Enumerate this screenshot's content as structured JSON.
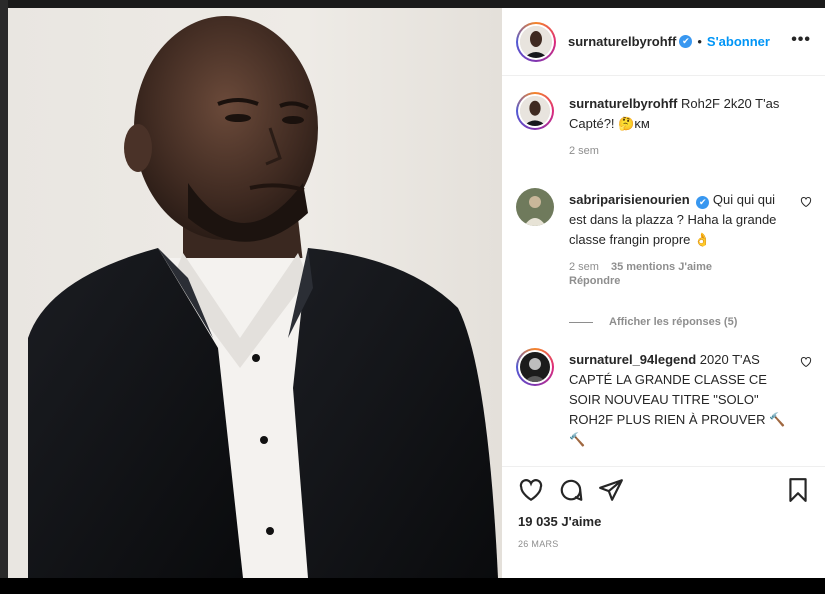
{
  "post": {
    "author": "surnaturelbyrohff",
    "verified_mark": "✔",
    "follow_label": "S'abonner",
    "more_glyph": "•••",
    "caption_text": "Roh2F 2k20 T'as Capté?! 🤔ᴋᴍ",
    "caption_time": "2 sem"
  },
  "comments": [
    {
      "user": "sabriparisienourien",
      "verified": true,
      "text": "Qui qui qui est dans la plazza ? Haha la grande classe frangin propre 👌",
      "time": "2 sem",
      "likes": "35 mentions J'aime",
      "reply": "Répondre",
      "view_replies": "Afficher les réponses (5)"
    },
    {
      "user": "surnaturel_94legend",
      "verified": false,
      "text": "2020 T'AS CAPTÉ LA GRANDE CLASSE CE SOIR NOUVEAU TITRE \"SOLO\" ROH2F PLUS RIEN À PROUVER 🔨🔨"
    }
  ],
  "footer": {
    "likes_count": "19 035 J'aime",
    "date": "26 MARS"
  },
  "icons": [
    "heart-icon",
    "comment-icon",
    "share-icon",
    "bookmark-icon",
    "more-options-icon",
    "verified-icon"
  ],
  "colors": {
    "accent": "#0095f6",
    "verified": "#3897f0",
    "muted": "#8e8e8e"
  }
}
